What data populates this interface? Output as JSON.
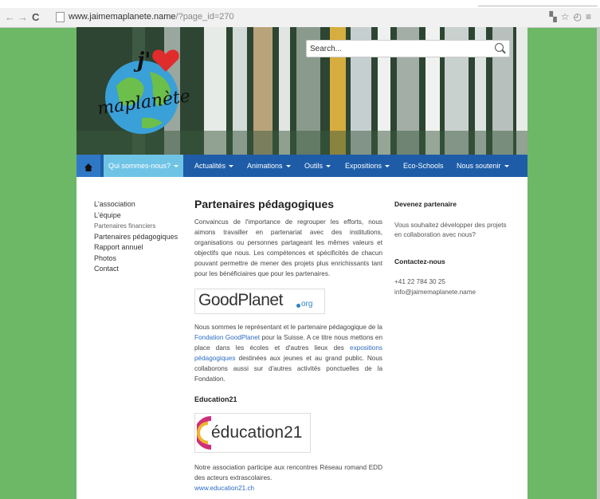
{
  "browser": {
    "url_domain": "www.jaimemaplanete.name",
    "url_path": "/?page_id=270"
  },
  "search": {
    "placeholder": "Search..."
  },
  "nav": {
    "items": [
      {
        "label": "Qui sommes-nous?",
        "active": true
      },
      {
        "label": "Actualités"
      },
      {
        "label": "Animations"
      },
      {
        "label": "Outils"
      },
      {
        "label": "Expositions"
      },
      {
        "label": "Eco-Schools"
      },
      {
        "label": "Nous soutenir"
      }
    ]
  },
  "sidebar": {
    "items": [
      "L'association",
      "L'équipe",
      "Partenaires financiers",
      "Partenaires pédagogiques",
      "Rapport annuel",
      "Photos",
      "Contact"
    ]
  },
  "main": {
    "title": "Partenaires pédagogiques",
    "intro": "Convaincus de l'importance de regrouper les efforts, nous aimons travailler en partenariat avec des institutions, organisations ou personnes partageant les mêmes valeurs et objectifs que nous. Les compétences et spécificités de chacun pouvant permettre de mener des projets plus enrichissants tant pour les bénéficiaires que pour les partenaires.",
    "goodplanet_logo": "GoodPlanet",
    "goodplanet_org": "org",
    "gp_p1": "Nous sommes le représentant et le partenaire pédagogique de la ",
    "gp_link1": "Fondation GoodPlanet",
    "gp_p2": " pour la Suisse. A ce titre nous mettons en place dans les écoles et d'autres lieux des ",
    "gp_link2": "expositions pédagogiques",
    "gp_p3": " destinées aux jeunes et au grand public. Nous collaborons aussi sur d'autres activités ponctuelles de la Fondation.",
    "education_heading": "Education21",
    "education_logo": "éducation21",
    "edu_text": "Notre association participe aux rencontres Réseau romand EDD des acteurs extrascolaires.",
    "edu_link": "www.education21.ch"
  },
  "right": {
    "partner_heading": "Devenez partenaire",
    "partner_text": "Vous souhaitez développer des projets en collaboration avec nous?",
    "contact_heading": "Contactez-nous",
    "phone": "+41 22 784 30 25",
    "email": "info@jaimemaplanete.name"
  },
  "colors": {
    "background": "#6cb866",
    "navbar": "#1e5ca8",
    "nav_active": "#6fc4e6",
    "link": "#2c6cc2"
  },
  "logo": {
    "line1": "j'",
    "line2": "maplanète"
  }
}
